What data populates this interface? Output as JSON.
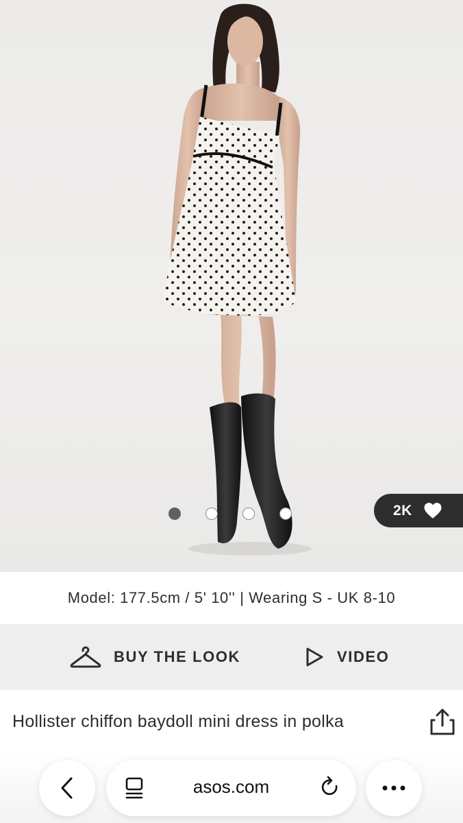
{
  "product": {
    "model_info": "Model: 177.5cm / 5' 10'' | Wearing S - UK 8-10",
    "title": "Hollister chiffon baydoll mini dress in polka",
    "saves_count": "2K",
    "carousel": {
      "total": 4,
      "active_index": 0
    }
  },
  "actions": {
    "buy_the_look": "BUY THE LOOK",
    "video": "VIDEO"
  },
  "browser": {
    "url": "asos.com"
  },
  "icons": {
    "heart": "heart-icon",
    "hanger": "hanger-icon",
    "play": "play-icon",
    "share": "share-icon",
    "back": "chevron-left-icon",
    "reader": "reader-mode-icon",
    "reload": "reload-icon",
    "more": "more-icon"
  },
  "colors": {
    "dark_pill": "#2d2d2d",
    "actions_bar_bg": "#eeeeee",
    "text": "#2d2d2d",
    "dot_active": "#5b6164"
  }
}
